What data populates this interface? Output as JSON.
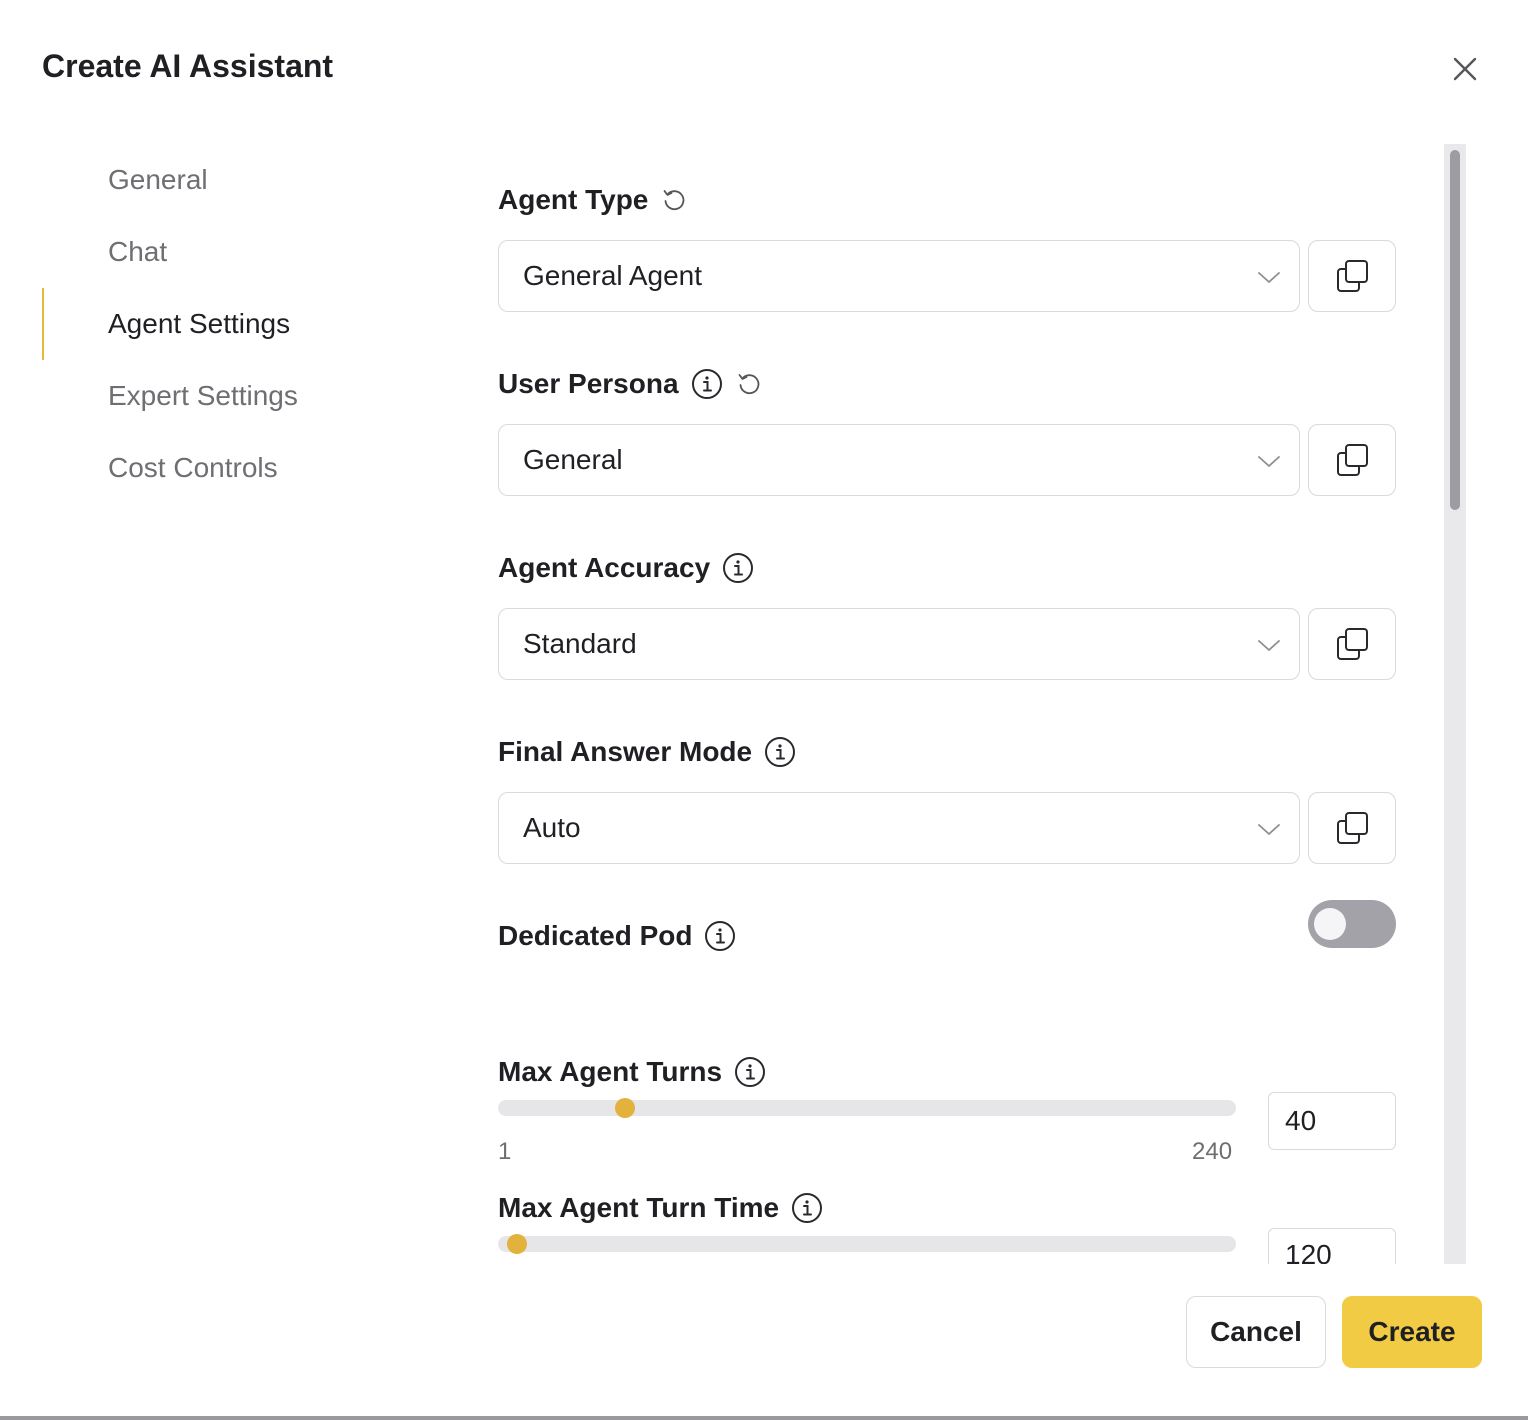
{
  "dialog": {
    "title": "Create AI Assistant"
  },
  "nav": {
    "items": [
      {
        "label": "General"
      },
      {
        "label": "Chat"
      },
      {
        "label": "Agent Settings",
        "active": true
      },
      {
        "label": "Expert Settings"
      },
      {
        "label": "Cost Controls"
      }
    ]
  },
  "fields": {
    "agent_type": {
      "label": "Agent Type",
      "value": "General Agent"
    },
    "user_persona": {
      "label": "User Persona",
      "value": "General"
    },
    "agent_accuracy": {
      "label": "Agent Accuracy",
      "value": "Standard"
    },
    "final_answer_mode": {
      "label": "Final Answer Mode",
      "value": "Auto"
    },
    "dedicated_pod": {
      "label": "Dedicated Pod",
      "enabled": false
    },
    "max_agent_turns": {
      "label": "Max Agent Turns",
      "min": "1",
      "max": "240",
      "value": "40"
    },
    "max_agent_turn_time": {
      "label": "Max Agent Turn Time",
      "value": "120"
    }
  },
  "buttons": {
    "cancel": "Cancel",
    "create": "Create"
  },
  "colors": {
    "accent": "#e3b23c",
    "create_bg": "#f2cb45",
    "toggle_off": "#a2a2a8"
  },
  "icons": [
    "close-icon",
    "reset-icon",
    "info-icon",
    "chevron-down-icon",
    "copy-icon"
  ]
}
